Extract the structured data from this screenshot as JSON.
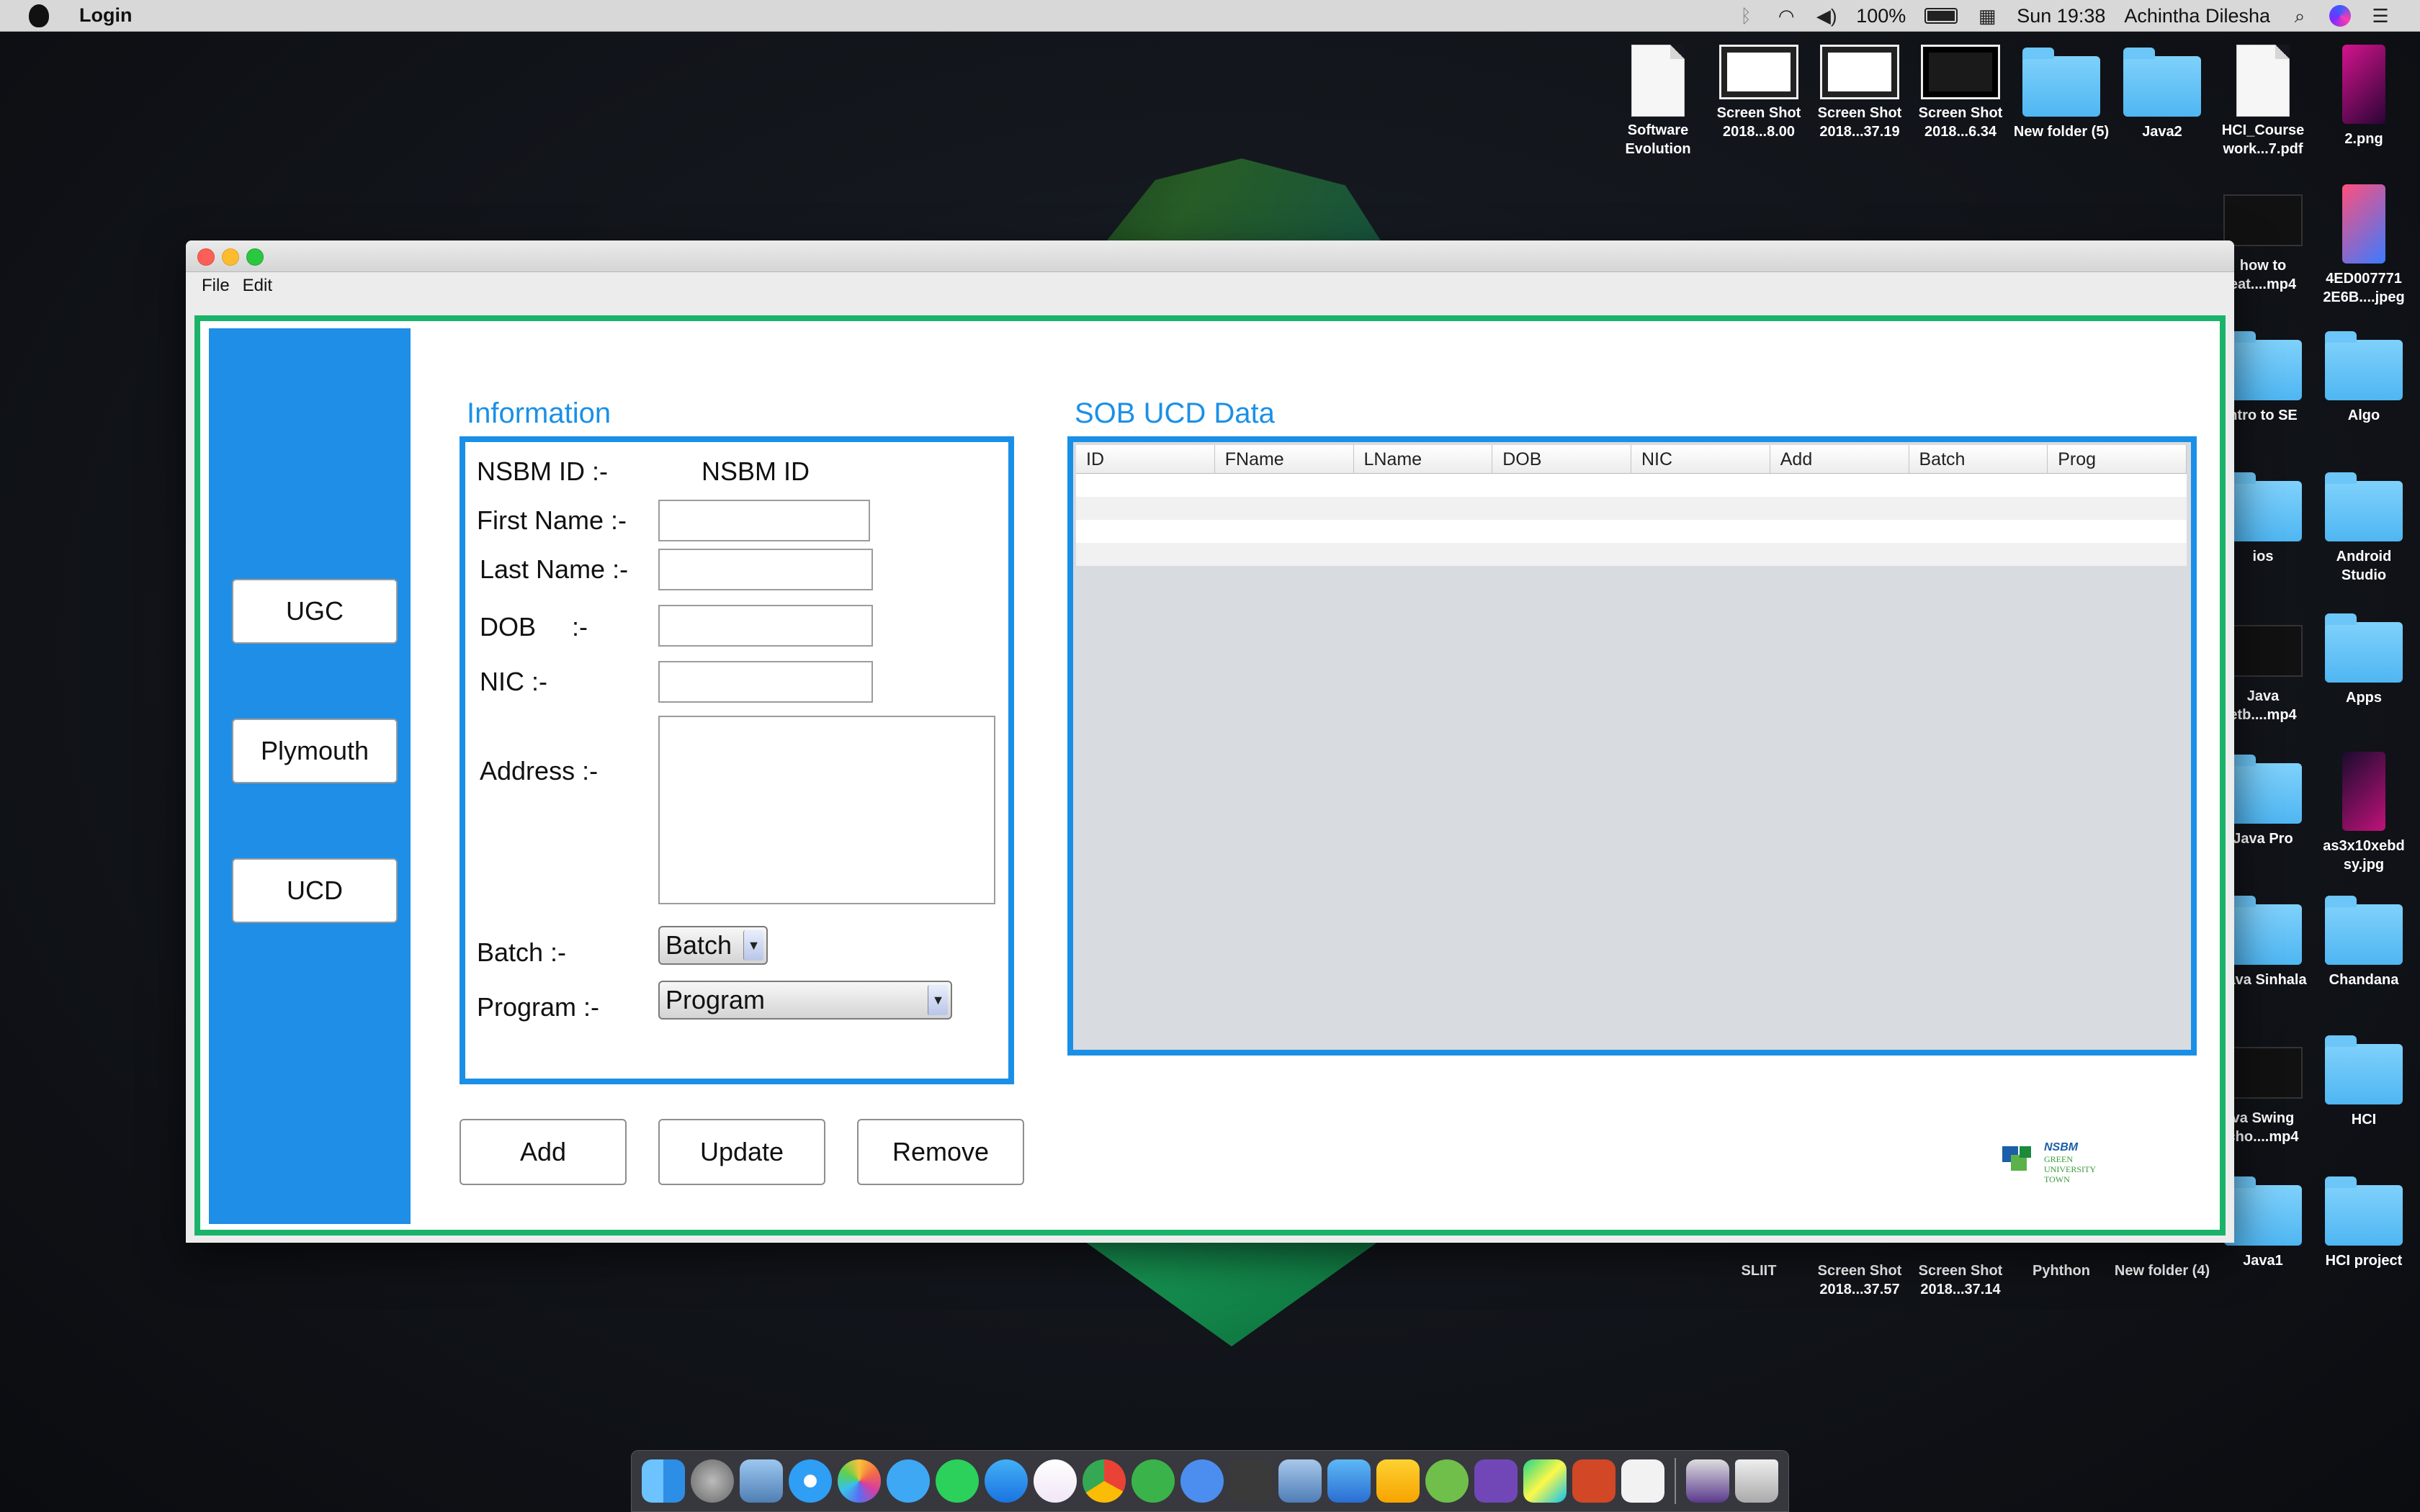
{
  "menubar": {
    "app_name": "Login",
    "battery": "100%",
    "clock": "Sun 19:38",
    "user": "Achintha Dilesha"
  },
  "desktop_icons": [
    {
      "label": "Software Evolution",
      "kind": "doc"
    },
    {
      "label": "Screen Shot 2018...8.00",
      "kind": "shot"
    },
    {
      "label": "Screen Shot 2018...37.19",
      "kind": "shot"
    },
    {
      "label": "Screen Shot 2018...6.34",
      "kind": "shot-dark"
    },
    {
      "label": "New folder (5)",
      "kind": "folder"
    },
    {
      "label": "Java2",
      "kind": "folder"
    },
    {
      "label": "HCI_Course work...7.pdf",
      "kind": "doc"
    },
    {
      "label": "2.png",
      "kind": "pic"
    },
    {
      "label": "how to eat....mp4",
      "kind": "video"
    },
    {
      "label": "4ED007771 2E6B....jpeg",
      "kind": "pic"
    },
    {
      "label": "ntro to SE",
      "kind": "folder"
    },
    {
      "label": "Algo",
      "kind": "folder"
    },
    {
      "label": "ios",
      "kind": "folder"
    },
    {
      "label": "Android Studio",
      "kind": "folder"
    },
    {
      "label": "Java etb....mp4",
      "kind": "video"
    },
    {
      "label": "Apps",
      "kind": "folder"
    },
    {
      "label": "Java Pro",
      "kind": "folder"
    },
    {
      "label": "as3x10xebd sy.jpg",
      "kind": "pic"
    },
    {
      "label": "Java Sinhala",
      "kind": "folder"
    },
    {
      "label": "Chandana",
      "kind": "folder"
    },
    {
      "label": "va Swing cho....mp4",
      "kind": "video"
    },
    {
      "label": "HCI",
      "kind": "folder"
    },
    {
      "label": "SLIIT",
      "kind": "none"
    },
    {
      "label": "Screen Shot 2018...37.57",
      "kind": "none"
    },
    {
      "label": "Screen Shot 2018...37.14",
      "kind": "none"
    },
    {
      "label": "Pyhthon",
      "kind": "none"
    },
    {
      "label": "New folder (4)",
      "kind": "none"
    },
    {
      "label": "Java1",
      "kind": "folder"
    },
    {
      "label": "HCI project",
      "kind": "folder"
    }
  ],
  "window": {
    "menus": [
      "File",
      "Edit"
    ],
    "sidebar_buttons": [
      "UGC",
      "Plymouth",
      "UCD"
    ],
    "info_title": "Information",
    "form": {
      "nsbm_id_label": "NSBM ID :-",
      "nsbm_id_value": "NSBM ID",
      "first_name_label": "First Name :-",
      "last_name_label": "Last Name :-",
      "dob_label": "DOB     :-",
      "nic_label": "NIC :-",
      "address_label": "Address :-",
      "batch_label": "Batch :-",
      "batch_value": "Batch",
      "program_label": "Program :-",
      "program_value": "Program"
    },
    "table_title": "SOB UCD Data",
    "table_columns": [
      "ID",
      "FName",
      "LName",
      "DOB",
      "NIC",
      "Add",
      "Batch",
      "Prog"
    ],
    "actions": [
      "Add",
      "Update",
      "Remove"
    ],
    "logo_text": [
      "NSBM",
      "GREEN",
      "UNIVERSITY",
      "TOWN"
    ]
  },
  "colors": {
    "sidebar": "#1f8ee6",
    "panel_border": "#1a8fe6",
    "frame_border": "#19b36a",
    "title_text": "#1a90e8"
  },
  "dock_apps": [
    "finder-icon",
    "launchpad-icon",
    "preview-icon",
    "safari-icon",
    "photos-icon",
    "messages-icon",
    "whatsapp-icon",
    "appstore-icon",
    "itunes-icon",
    "chrome-icon",
    "cloud-app-icon",
    "icloud-icon",
    "sublime-icon",
    "virtualbox-icon",
    "xcode-icon",
    "sketch-icon",
    "android-studio-icon",
    "visual-studio-icon",
    "pycharm-icon",
    "powerpoint-icon",
    "java-icon",
    "screen-icon",
    "trash-icon"
  ]
}
